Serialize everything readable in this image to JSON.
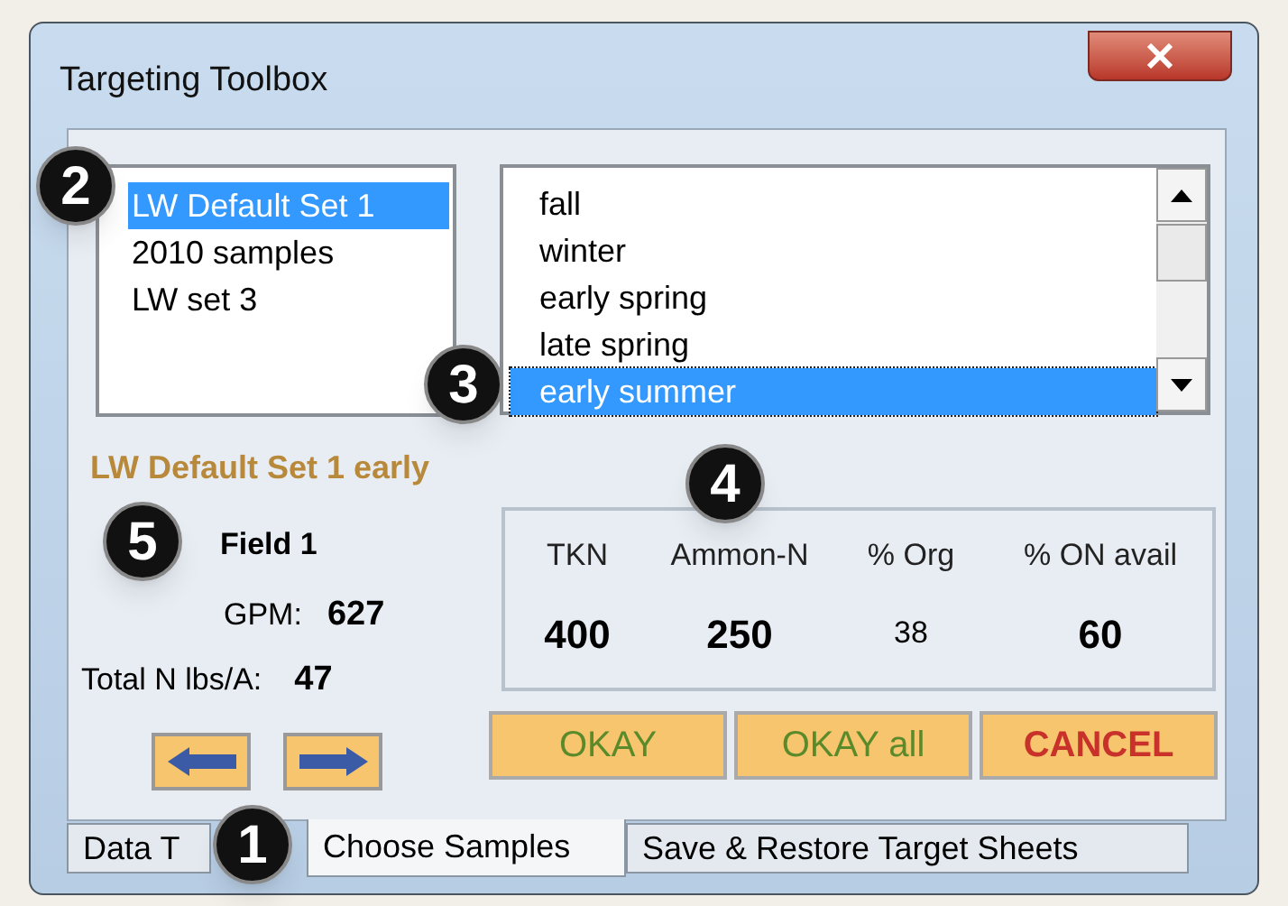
{
  "window": {
    "title": "Targeting Toolbox"
  },
  "sample_sets": [
    {
      "label": "LW Default Set 1",
      "selected": true
    },
    {
      "label": "2010 samples",
      "selected": false
    },
    {
      "label": "LW set 3",
      "selected": false
    }
  ],
  "seasons": [
    {
      "label": "fall",
      "selected": false
    },
    {
      "label": "winter",
      "selected": false
    },
    {
      "label": "early spring",
      "selected": false
    },
    {
      "label": "late spring",
      "selected": false
    },
    {
      "label": "early summer",
      "selected": true
    }
  ],
  "selection_label": "LW Default Set 1 early",
  "field": {
    "name": "Field 1",
    "gpm_label": "GPM:",
    "gpm": "627",
    "total_n_label": "Total N lbs/A:",
    "total_n": "47"
  },
  "nutrients": [
    {
      "label": "TKN",
      "value": "400",
      "bold": true
    },
    {
      "label": "Ammon-N",
      "value": "250",
      "bold": true
    },
    {
      "label": "% Org",
      "value": "38",
      "bold": false
    },
    {
      "label": "% ON avail",
      "value": "60",
      "bold": true
    }
  ],
  "buttons": [
    {
      "label": "OKAY",
      "kind": "confirm"
    },
    {
      "label": "OKAY all",
      "kind": "confirm"
    },
    {
      "label": "CANCEL",
      "kind": "cancel"
    }
  ],
  "tabs": [
    {
      "label": "Data T",
      "selected": false
    },
    {
      "label": "Choose Samples",
      "selected": true
    },
    {
      "label": "Save & Restore Target Sheets",
      "selected": false
    }
  ],
  "callouts": [
    "2",
    "3",
    "4",
    "5",
    "1"
  ]
}
